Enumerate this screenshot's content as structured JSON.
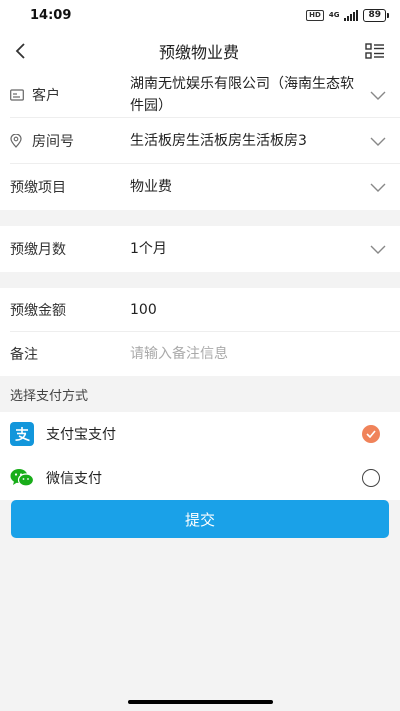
{
  "status": {
    "time": "14:09",
    "hd": "HD",
    "network": "4G",
    "battery": "89"
  },
  "nav": {
    "title": "预缴物业费"
  },
  "form": {
    "customer_label": "客户",
    "customer_value": "湖南无忧娱乐有限公司（海南生态软件园）",
    "room_label": "房间号",
    "room_value": "生活板房生活板房生活板房3",
    "item_label": "预缴项目",
    "item_value": "物业费",
    "months_label": "预缴月数",
    "months_value": "1个月",
    "amount_label": "预缴金额",
    "amount_value": "100",
    "note_label": "备注",
    "note_placeholder": "请输入备注信息"
  },
  "payment": {
    "section_title": "选择支付方式",
    "alipay_label": "支付宝支付",
    "wechat_label": "微信支付",
    "selected": "alipay"
  },
  "submit_label": "提交",
  "colors": {
    "accent": "#1aa1e8",
    "selected": "#f0835a",
    "alipay": "#1296db",
    "wechat": "#19ad1a"
  },
  "icons": [
    "back-arrow-icon",
    "menu-list-icon",
    "id-card-icon",
    "location-pin-icon",
    "chevron-down-icon",
    "alipay-icon",
    "wechat-icon",
    "check-icon"
  ]
}
